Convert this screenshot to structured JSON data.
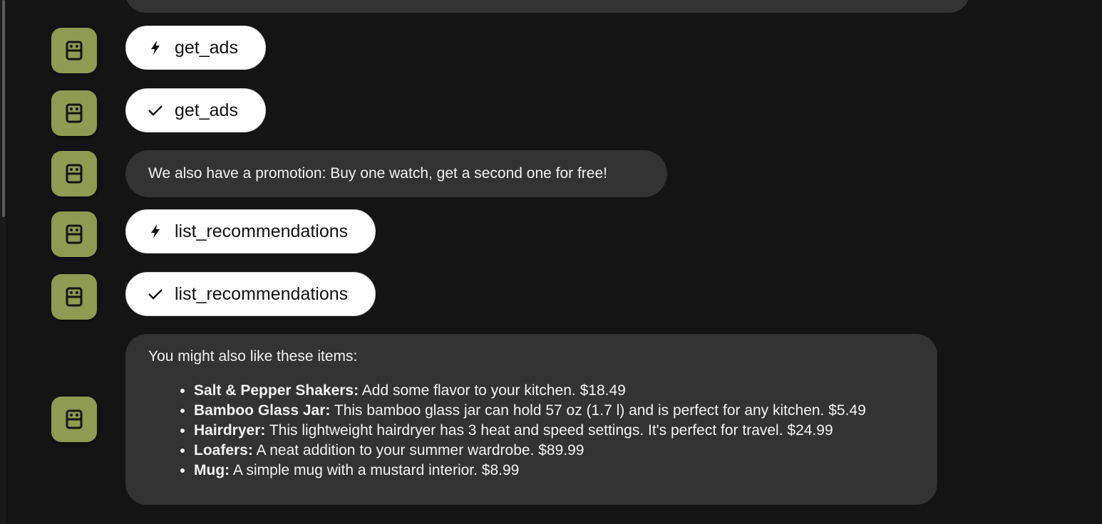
{
  "messages": {
    "tool_call_1": {
      "icon": "lightning-bolt-icon",
      "label": "get_ads"
    },
    "tool_result_1": {
      "icon": "checkmark-icon",
      "label": "get_ads"
    },
    "promo_text": "We also have a promotion: Buy one watch, get a second one for free!",
    "tool_call_2": {
      "icon": "lightning-bolt-icon",
      "label": "list_recommendations"
    },
    "tool_result_2": {
      "icon": "checkmark-icon",
      "label": "list_recommendations"
    },
    "recommendations": {
      "intro": "You might also like these items:",
      "items": [
        {
          "name": "Salt & Pepper Shakers:",
          "desc": " Add some flavor to your kitchen. $18.49"
        },
        {
          "name": "Bamboo Glass Jar:",
          "desc": " This bamboo glass jar can hold 57 oz (1.7 l) and is perfect for any kitchen. $5.49"
        },
        {
          "name": "Hairdryer:",
          "desc": " This lightweight hairdryer has 3 heat and speed settings. It's perfect for travel. $24.99"
        },
        {
          "name": "Loafers:",
          "desc": " A neat addition to your summer wardrobe. $89.99"
        },
        {
          "name": "Mug:",
          "desc": " A simple mug with a mustard interior. $8.99"
        }
      ]
    }
  },
  "colors": {
    "background": "#141414",
    "bubble": "#333333",
    "avatar": "#8f9a52",
    "pill": "#ffffff"
  },
  "avatar_icon": "robot-face-icon"
}
